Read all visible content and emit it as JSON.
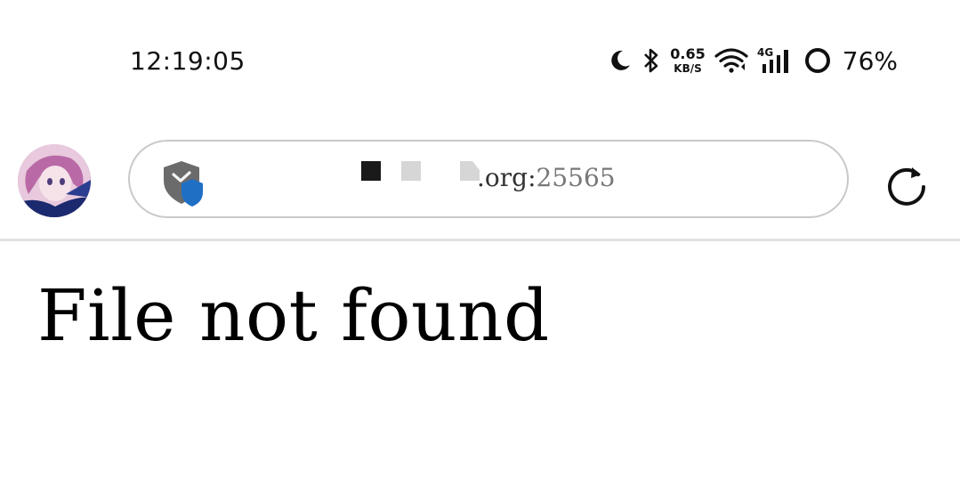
{
  "status_bar": {
    "time": "12:19:05",
    "net_speed_value": "0.65",
    "net_speed_unit": "KB/S",
    "network_label": "4G",
    "battery_percent": "76%",
    "icons": [
      "moon-icon",
      "bluetooth-icon",
      "wifi-icon",
      "signal-icon",
      "battery-ring-icon"
    ]
  },
  "toolbar": {
    "url_domain_suffix": ".org:",
    "url_port": "25565",
    "icons": [
      "avatar",
      "shield-icon",
      "reload-icon"
    ]
  },
  "content": {
    "heading": "File not found"
  },
  "colors": {
    "shield_blue": "#1f6fc5",
    "shield_gray": "#6b6b6b",
    "divider": "#e2e2e2"
  }
}
